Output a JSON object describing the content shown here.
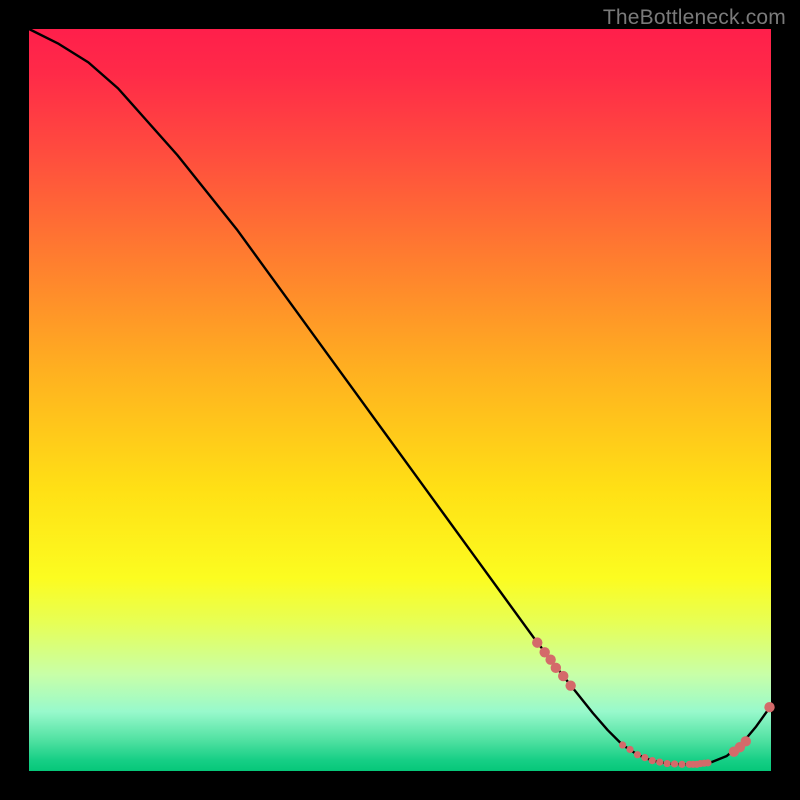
{
  "watermark": "TheBottleneck.com",
  "chart_data": {
    "type": "line",
    "title": "",
    "xlabel": "",
    "ylabel": "",
    "xlim": [
      0,
      100
    ],
    "ylim": [
      0,
      100
    ],
    "grid": false,
    "legend": false,
    "series": [
      {
        "name": "curve",
        "color": "#000000",
        "x": [
          0,
          4,
          8,
          12,
          16,
          20,
          24,
          28,
          32,
          36,
          40,
          44,
          48,
          52,
          56,
          60,
          64,
          68,
          72,
          76,
          78,
          80,
          82,
          84,
          86,
          88,
          90,
          92,
          94,
          96,
          98,
          100
        ],
        "y": [
          100,
          98,
          95.5,
          92,
          87.5,
          83,
          78,
          73,
          67.5,
          62,
          56.5,
          51,
          45.5,
          40,
          34.5,
          29,
          23.5,
          18,
          12.8,
          7.8,
          5.5,
          3.5,
          2.2,
          1.4,
          1.0,
          0.9,
          0.9,
          1.2,
          2.0,
          3.6,
          6.0,
          8.8
        ]
      }
    ],
    "markers": [
      {
        "color": "#d46a6a",
        "r_large": 5.2,
        "r_small": 3.6,
        "points_large": [
          {
            "x": 68.5,
            "y": 17.3
          },
          {
            "x": 69.5,
            "y": 16.0
          },
          {
            "x": 70.3,
            "y": 15.0
          },
          {
            "x": 71.0,
            "y": 13.9
          },
          {
            "x": 72.0,
            "y": 12.8
          },
          {
            "x": 73.0,
            "y": 11.5
          },
          {
            "x": 95.0,
            "y": 2.6
          },
          {
            "x": 95.8,
            "y": 3.2
          },
          {
            "x": 96.6,
            "y": 4.0
          },
          {
            "x": 99.8,
            "y": 8.6
          }
        ],
        "points_small": [
          {
            "x": 80.0,
            "y": 3.5
          },
          {
            "x": 81.0,
            "y": 2.9
          },
          {
            "x": 82.0,
            "y": 2.2
          },
          {
            "x": 83.0,
            "y": 1.8
          },
          {
            "x": 84.0,
            "y": 1.4
          },
          {
            "x": 85.0,
            "y": 1.2
          },
          {
            "x": 86.0,
            "y": 1.0
          },
          {
            "x": 87.0,
            "y": 0.95
          },
          {
            "x": 88.0,
            "y": 0.9
          },
          {
            "x": 89.0,
            "y": 0.9
          },
          {
            "x": 89.5,
            "y": 0.9
          },
          {
            "x": 90.0,
            "y": 0.9
          },
          {
            "x": 90.5,
            "y": 1.0
          },
          {
            "x": 91.0,
            "y": 1.05
          },
          {
            "x": 91.5,
            "y": 1.1
          }
        ]
      }
    ]
  }
}
